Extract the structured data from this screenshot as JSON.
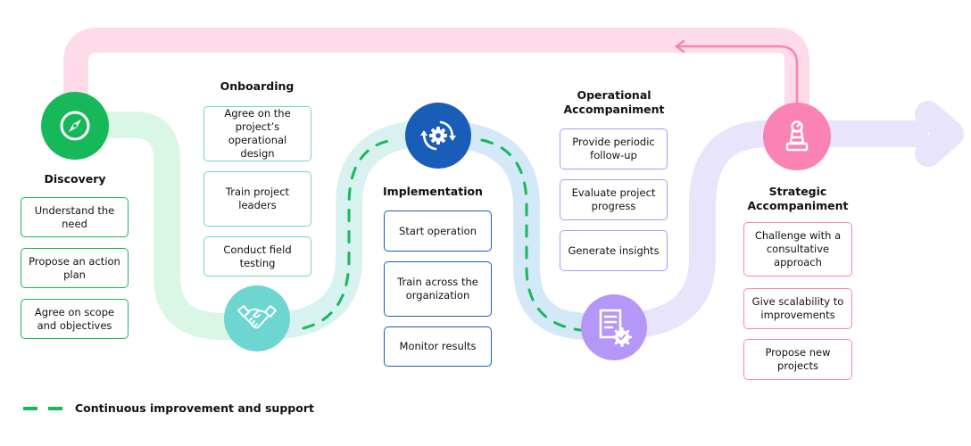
{
  "colors": {
    "discovery": "#17b85a",
    "discovery_track": "#d9f7e4",
    "onboarding": "#6dd6d0",
    "onboarding_track": "#d8f2f1",
    "implementation": "#1a5db8",
    "implementation_track": "#d3e9f7",
    "operational": "#b497f7",
    "operational_track": "#e8e4fb",
    "strategic": "#fb83b4",
    "strategic_track": "#fddbe8",
    "dashed": "#17b85a"
  },
  "stages": [
    {
      "id": "discovery",
      "title": "Discovery",
      "icon": "compass-icon",
      "steps": [
        "Understand the need",
        "Propose an action plan",
        "Agree on scope and objectives"
      ]
    },
    {
      "id": "onboarding",
      "title": "Onboarding",
      "icon": "handshake-icon",
      "steps": [
        "Agree on the project’s operational design",
        "Train project leaders",
        "Conduct field testing"
      ]
    },
    {
      "id": "implementation",
      "title": "Implementation",
      "icon": "gear-cycle-icon",
      "steps": [
        "Start operation",
        "Train across the organization",
        "Monitor results"
      ]
    },
    {
      "id": "operational",
      "title": "Operational Accompaniment",
      "icon": "document-gear-icon",
      "steps": [
        "Provide periodic follow-up",
        "Evaluate project progress",
        "Generate insights"
      ]
    },
    {
      "id": "strategic",
      "title": "Strategic Accompaniment",
      "icon": "chess-pawn-icon",
      "steps": [
        "Challenge with a consultative approach",
        "Give scalability to improvements",
        "Propose new projects"
      ]
    }
  ],
  "legend": {
    "label": "Continuous improvement and support",
    "icon": "dashed-line-icon"
  }
}
